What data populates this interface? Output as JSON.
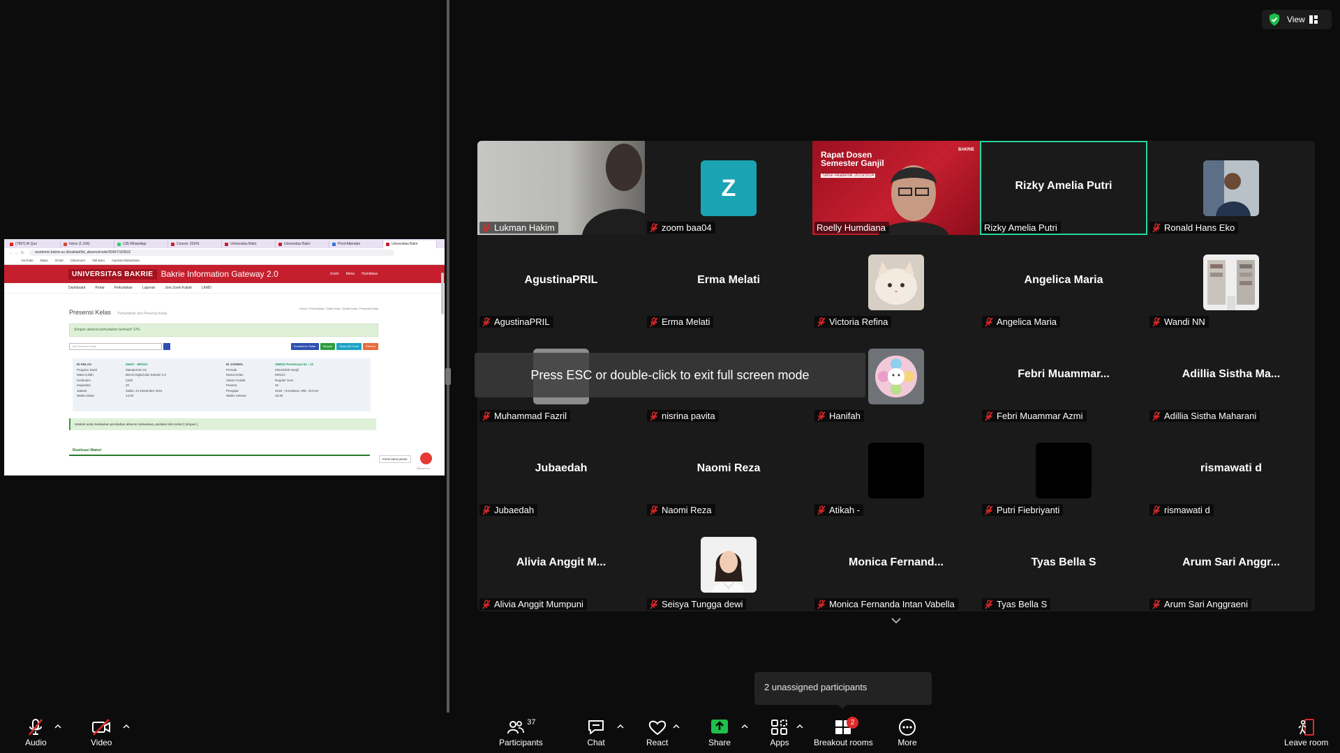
{
  "shared_screen": {
    "browser_tabs": [
      {
        "label": "(7897) AI Quo",
        "color": "#e62117"
      },
      {
        "label": "Inbox (1.104)",
        "color": "#d14836"
      },
      {
        "label": "(18) WhatsApp",
        "color": "#25d366"
      },
      {
        "label": "Course: 20241",
        "color": "#c51f2e"
      },
      {
        "label": "Universitas Bakri",
        "color": "#c51f2e"
      },
      {
        "label": "Universitas Bakri",
        "color": "#c51f2e"
      },
      {
        "label": "Pivot Attendan",
        "color": "#3b6fd4"
      },
      {
        "label": "Universitas Bakri",
        "color": "#c51f2e"
      }
    ],
    "address": "academic.bakrie.ac.id/zaklad/list_absensi/code/26457/169532",
    "bookmarks": [
      "YouTube",
      "Maps",
      "Gmail",
      "Classroom",
      "Tab Baru",
      "Aspirasi Mahasiswa"
    ],
    "site": {
      "logo": "UNIVERSITAS BAKRIE",
      "title": "Bakrie Information Gateway 2.0",
      "header_links": [
        "Zoom",
        "Menu",
        "Humdiana"
      ],
      "nav": [
        "Dashboard",
        "Portal",
        "Perkuliahan",
        "Laporan",
        "Join Zoom Kuliah",
        "LKMD"
      ],
      "page_title": "Presensi Kelas",
      "page_sub": "Perkuliahan dan Presensi Kelas",
      "breadcrumb": "Home  /  Perkuliahan  /  Data Kelas  /  Detail Kelas  /  Presensi Kelas",
      "alert_saved": "Simpan absensi perkuliahan berhasil! 12%.",
      "search_placeholder": "Cari Presensi Kelas",
      "buttons": [
        {
          "label": "Kembali ke Daftar",
          "color": "#2f4fb2"
        },
        {
          "label": "Simpan",
          "color": "#2e9d3e"
        },
        {
          "label": "Show QR Code",
          "color": "#1aa3c6"
        },
        {
          "label": "Refresh",
          "color": "#e86a3a"
        }
      ],
      "info_left": [
        [
          "ID KELAS",
          "26457 - MR22A"
        ],
        [
          "Program Studi",
          "Manajemen S1"
        ],
        [
          "Mata Kuliah",
          "Bisnis Digital dan Industri 4.0"
        ],
        [
          "Kurikulum",
          "2245"
        ],
        [
          "Kapasitas",
          "40"
        ],
        [
          "Jadwal",
          "Sabtu, 21 Desember 2024"
        ],
        [
          "Waktu Mulai",
          "14:00"
        ]
      ],
      "info_right": [
        [
          "ID JADWAL",
          "169532 Pertemuan ke - 13"
        ],
        [
          "Periode",
          "2024/2025 Ganjil"
        ],
        [
          "Nama Kelas",
          "MR22A"
        ],
        [
          "Sistem Kuliah",
          "Reguler Sore"
        ],
        [
          "Peserta",
          "40"
        ],
        [
          "Pengajar",
          "3139 - Humdiana, MM., M.Kom"
        ],
        [
          "Waktu Selesai",
          "16:30"
        ]
      ],
      "alert_hint": "Setelah anda melakukan perubahan absensi mahasiswa, pastikan klik tombol [ Simpan ]",
      "section": "Realisasi Materi",
      "chat_pill": "Kirimi kami pesan",
      "chat_fab_label": "Qiscus Inc"
    }
  },
  "grid": {
    "tiles": [
      {
        "name": "Lukman Hakim",
        "kind": "video-person",
        "muted": true
      },
      {
        "name": "zoom baa04",
        "kind": "letter",
        "letter": "Z",
        "muted": true
      },
      {
        "name": "Roelly Humdiana",
        "kind": "video-presenter",
        "muted": false,
        "banner_lines": [
          "Rapat Dosen",
          "Semester Ganjil",
          "Tahun Akademik 2023/2024"
        ],
        "banner_brand": "BAKRIE"
      },
      {
        "name": "Rizky Amelia Putri",
        "kind": "name",
        "center": "Rizky Amelia Putri",
        "muted": false,
        "speaker": true
      },
      {
        "name": "Ronald Hans Eko",
        "kind": "avatar-person",
        "muted": true
      },
      {
        "name": "AgustinaPRIL",
        "kind": "name",
        "center": "AgustinaPRIL",
        "muted": true
      },
      {
        "name": "Erma Melati",
        "kind": "name",
        "center": "Erma Melati",
        "muted": true
      },
      {
        "name": "Victoria Refina",
        "kind": "avatar-cat",
        "muted": true
      },
      {
        "name": "Angelica Maria",
        "kind": "name",
        "center": "Angelica Maria",
        "muted": true
      },
      {
        "name": "Wandi NN",
        "kind": "avatar-room",
        "muted": true
      },
      {
        "name": "Muhammad Fazril",
        "kind": "avatar-dim",
        "muted": true
      },
      {
        "name": "nisrina pavita",
        "kind": "blank",
        "muted": true
      },
      {
        "name": "Hanifah",
        "kind": "avatar-flower",
        "muted": true
      },
      {
        "name": "Febri Muammar Azmi",
        "kind": "name",
        "center": "Febri  Muammar...",
        "muted": true
      },
      {
        "name": "Adillia Sistha Maharani",
        "kind": "name",
        "center": "Adillia  Sistha  Ma...",
        "muted": true
      },
      {
        "name": "Jubaedah",
        "kind": "name",
        "center": "Jubaedah",
        "muted": true
      },
      {
        "name": "Naomi Reza",
        "kind": "name",
        "center": "Naomi Reza",
        "muted": true
      },
      {
        "name": "Atikah -",
        "kind": "avatar-black",
        "muted": true
      },
      {
        "name": "Putri Fiebriyanti",
        "kind": "avatar-black",
        "muted": true
      },
      {
        "name": "rismawati d",
        "kind": "name",
        "center": "rismawati d",
        "muted": true
      },
      {
        "name": "Alivia Anggit Mumpuni",
        "kind": "name",
        "center": "Alivia  Anggit  M...",
        "muted": true
      },
      {
        "name": "Seisya Tungga dewi",
        "kind": "avatar-woman",
        "muted": true
      },
      {
        "name": "Monica Fernanda Intan Vabella",
        "kind": "name",
        "center": "Monica  Fernand...",
        "muted": true
      },
      {
        "name": "Tyas Bella S",
        "kind": "name",
        "center": "Tyas Bella S",
        "muted": true
      },
      {
        "name": "Arum Sari Anggraeni",
        "kind": "name",
        "center": "Arum  Sari  Anggr...",
        "muted": true
      }
    ]
  },
  "overlay": {
    "esc_toast": "Press ESC or double-click to exit full screen mode",
    "view_label": "View",
    "unassigned": "2 unassigned participants"
  },
  "toolbar": {
    "audio": "Audio",
    "video": "Video",
    "participants": "Participants",
    "participants_count": "37",
    "chat": "Chat",
    "react": "React",
    "share": "Share",
    "apps": "Apps",
    "breakout": "Breakout rooms",
    "breakout_badge": "2",
    "more": "More",
    "leave": "Leave room"
  },
  "colors": {
    "speaker_outline": "#23d9a0",
    "muted_red": "#e02828",
    "share_green": "#1fbf4a",
    "letter_avatar": "#1aa3b3"
  }
}
